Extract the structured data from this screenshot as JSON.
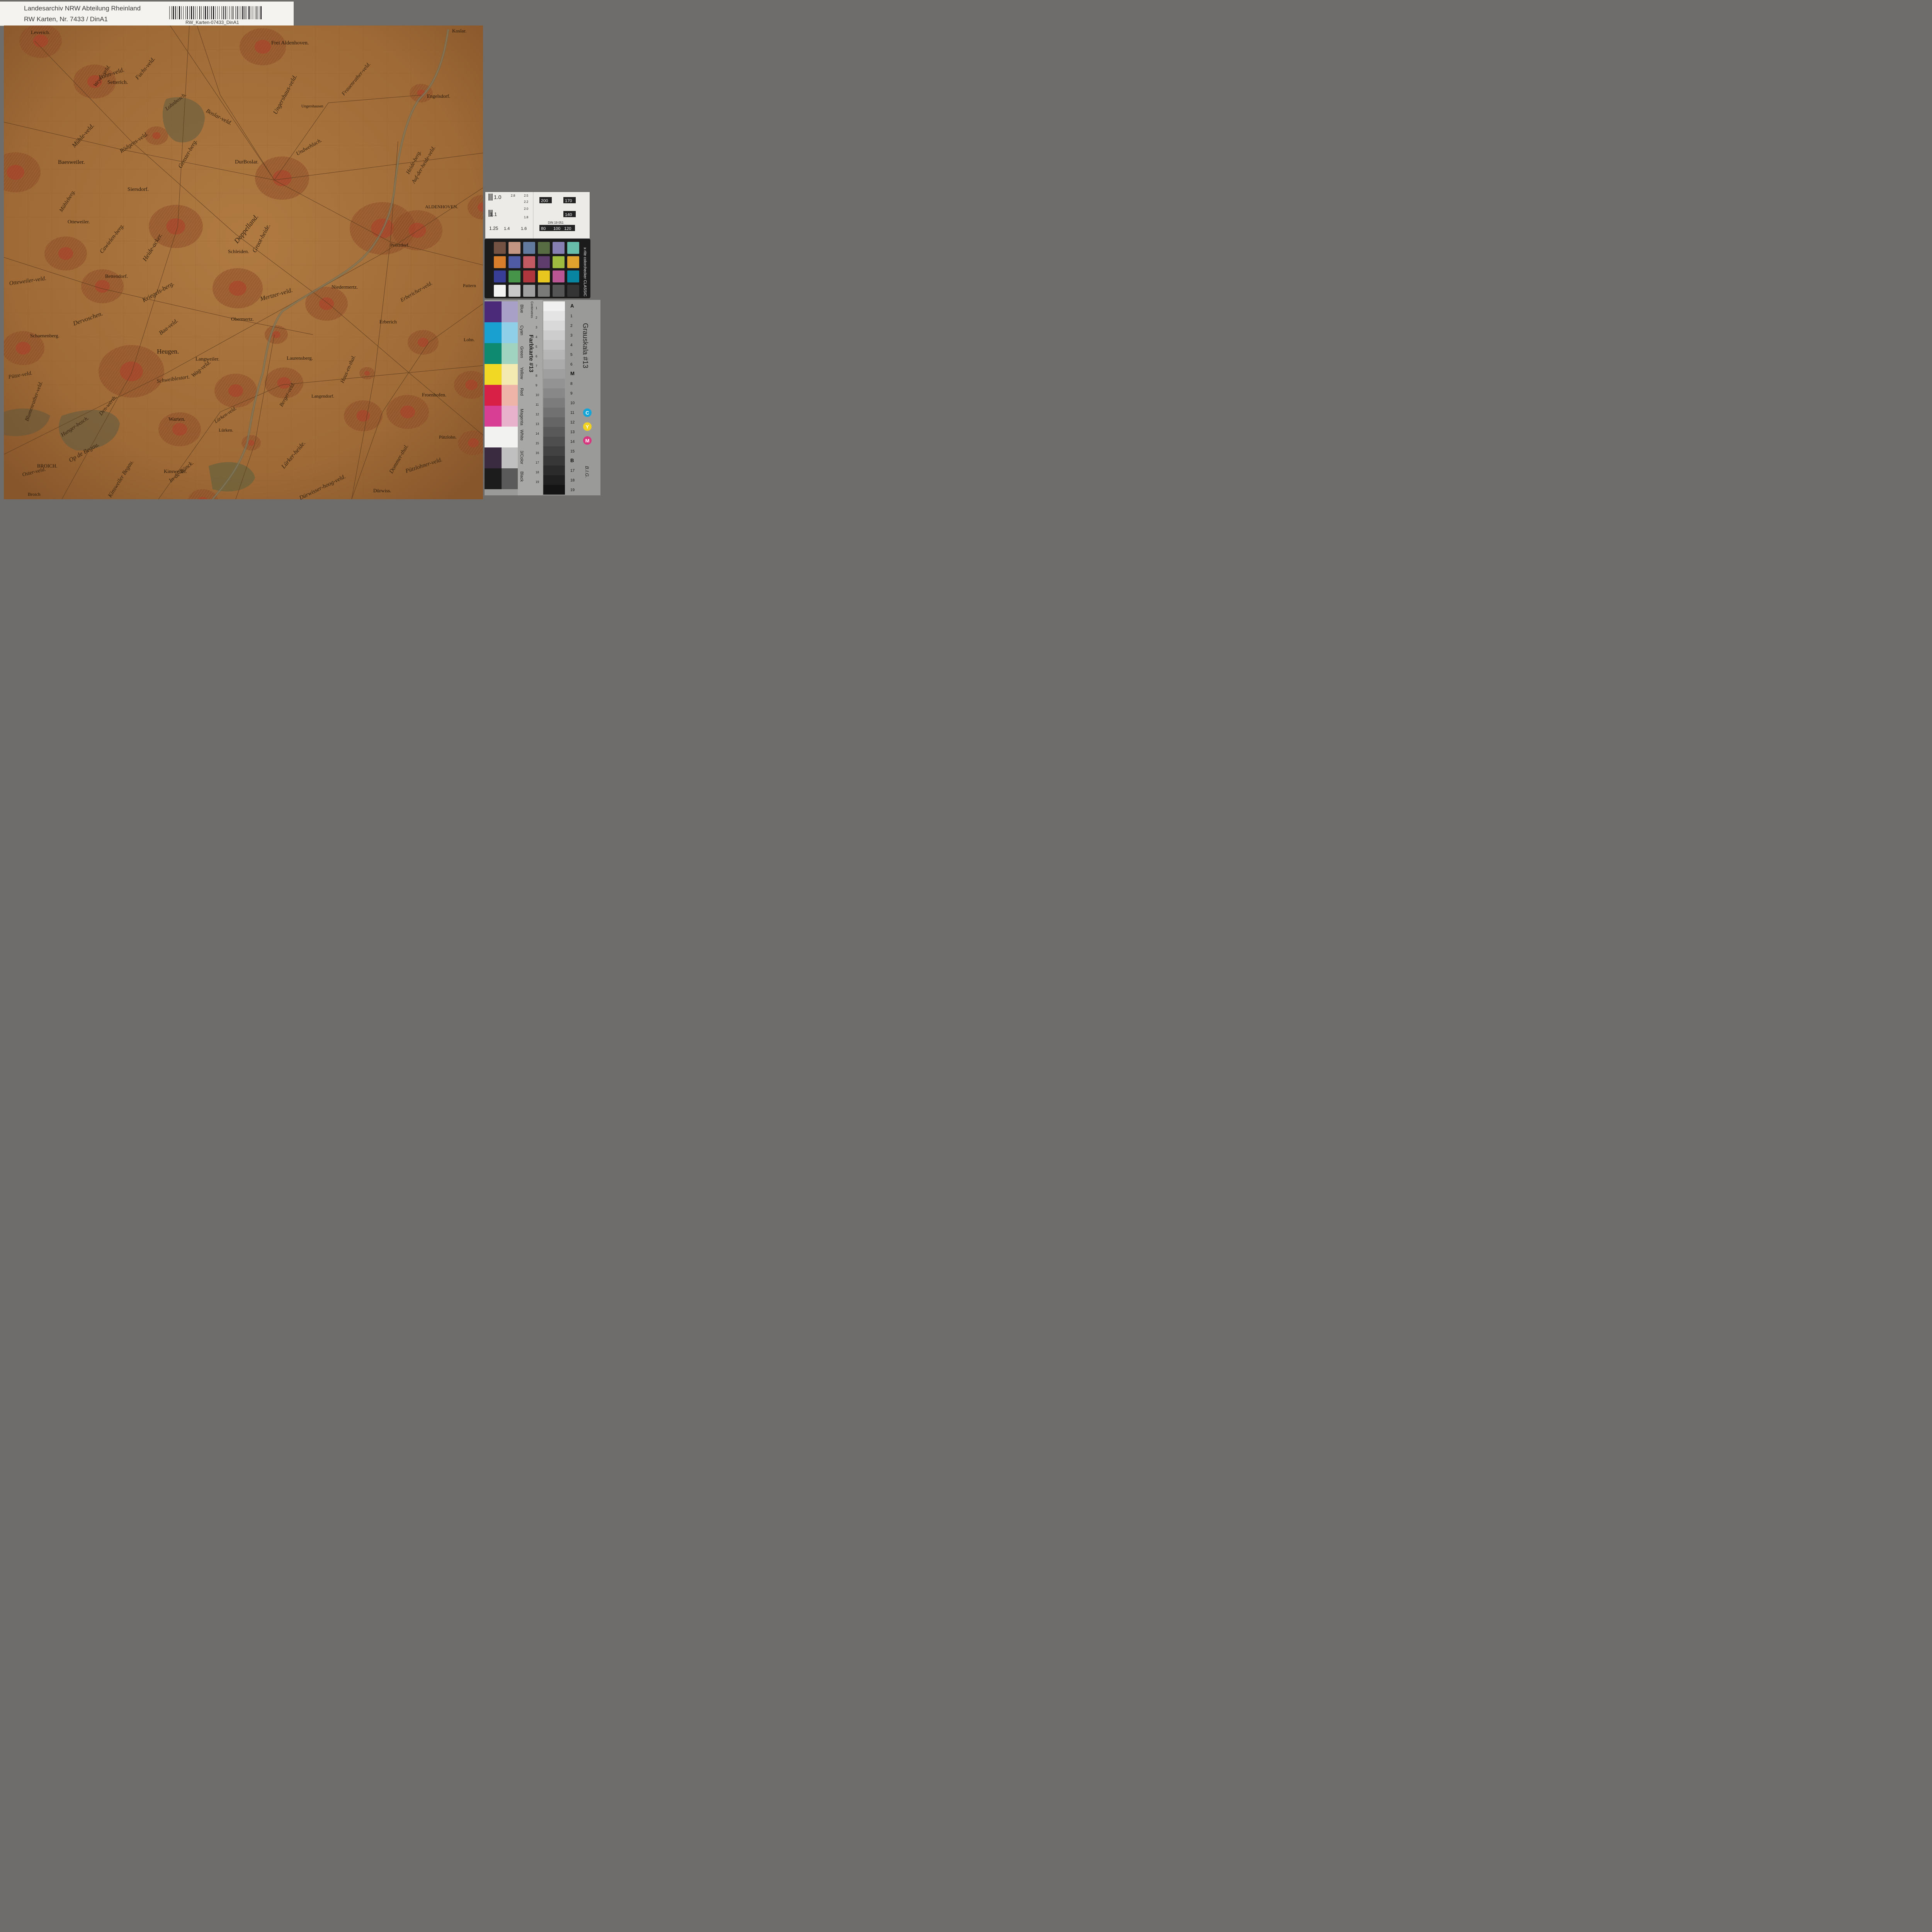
{
  "label": {
    "line1": "Landesarchiv NRW Abteilung Rheinland",
    "line2": "RW Karten,  Nr. 7433 / DinA1",
    "barcode_text": "RW_Karten-07433_DinA1"
  },
  "map": {
    "places": [
      {
        "name": "Leverich.",
        "size": 13
      },
      {
        "name": "Frei Aldenhoven.",
        "size": 14
      },
      {
        "name": "Koslar.",
        "size": 13
      },
      {
        "name": "Setterich.",
        "size": 14
      },
      {
        "name": "Engelsdorf.",
        "size": 13
      },
      {
        "name": "Ungershausen",
        "size": 10
      },
      {
        "name": "Baesweiler.",
        "size": 15
      },
      {
        "name": "DurBoslar.",
        "size": 14
      },
      {
        "name": "Siersdorf.",
        "size": 14
      },
      {
        "name": "ALDENHOVEN.",
        "size": 12
      },
      {
        "name": "Otteweiler.",
        "size": 13
      },
      {
        "name": "Schleiden.",
        "size": 13
      },
      {
        "name": "Pentzdorf.",
        "size": 12
      },
      {
        "name": "Bettendorf.",
        "size": 13
      },
      {
        "name": "Niedermertz.",
        "size": 13
      },
      {
        "name": "Pattern",
        "size": 12
      },
      {
        "name": "Obermertz.",
        "size": 13
      },
      {
        "name": "Erberich",
        "size": 13
      },
      {
        "name": "Schaenenberg.",
        "size": 13
      },
      {
        "name": "Heugen.",
        "size": 17
      },
      {
        "name": "Langweiler.",
        "size": 13
      },
      {
        "name": "Laurensberg.",
        "size": 13
      },
      {
        "name": "Lohn.",
        "size": 12
      },
      {
        "name": "Langendorf.",
        "size": 12
      },
      {
        "name": "Froenhofen.",
        "size": 13
      },
      {
        "name": "Warten.",
        "size": 14
      },
      {
        "name": "Lürken.",
        "size": 12
      },
      {
        "name": "Pützlohn.",
        "size": 12
      },
      {
        "name": "Kinsweiler.",
        "size": 13
      },
      {
        "name": "BROICH.",
        "size": 13
      },
      {
        "name": "Broich",
        "size": 12
      },
      {
        "name": "Dürwiss.",
        "size": 13
      }
    ],
    "fields": [
      {
        "name": "Weyer-veld.",
        "size": 14
      },
      {
        "name": "Fuchs-veld.",
        "size": 15
      },
      {
        "name": "Lohn-veld.",
        "size": 16
      },
      {
        "name": "Ungershaus-veld.",
        "size": 16
      },
      {
        "name": "Frauenrather-veld.",
        "size": 14
      },
      {
        "name": "Lohnbosch.",
        "size": 14
      },
      {
        "name": "Boslar-veld.",
        "size": 15
      },
      {
        "name": "Mühle-veld.",
        "size": 16
      },
      {
        "name": "Rödgens-veld.",
        "size": 15
      },
      {
        "name": "Undwehlach.",
        "size": 14
      },
      {
        "name": "Genster-berg.",
        "size": 15
      },
      {
        "name": "Mühleberg.",
        "size": 14
      },
      {
        "name": "Heide-berg.",
        "size": 14
      },
      {
        "name": "Auf-der-heide-veld.",
        "size": 14
      },
      {
        "name": "Doppelland.",
        "size": 18
      },
      {
        "name": "Groot-heide.",
        "size": 16
      },
      {
        "name": "Cawielen-berg.",
        "size": 15
      },
      {
        "name": "Heide-acker.",
        "size": 16
      },
      {
        "name": "Otteweiler-veld.",
        "size": 15
      },
      {
        "name": "Kriegels-berg.",
        "size": 16
      },
      {
        "name": "Dervoschen.",
        "size": 16
      },
      {
        "name": "Mertzer-veld.",
        "size": 16
      },
      {
        "name": "Erbericher-veld.",
        "size": 14
      },
      {
        "name": "Haus-en-thal.",
        "size": 14
      },
      {
        "name": "Baa-veld.",
        "size": 15
      },
      {
        "name": "Wag-veld.",
        "size": 15
      },
      {
        "name": "Pütze-veld.",
        "size": 14
      },
      {
        "name": "Schweiblestart.",
        "size": 14
      },
      {
        "name": "Den-werth.",
        "size": 14
      },
      {
        "name": "Lürken-veld.",
        "size": 13
      },
      {
        "name": "Hunger-bosch.",
        "size": 14
      },
      {
        "name": "Op de Begau.",
        "size": 16
      },
      {
        "name": "Lürker-heide.",
        "size": 16
      },
      {
        "name": "Dommer-thal.",
        "size": 15
      },
      {
        "name": "Kinsweiler Begau.",
        "size": 15
      },
      {
        "name": "In-de-Bünck.",
        "size": 15
      },
      {
        "name": "Dürwisser-hoog-veld.",
        "size": 15
      },
      {
        "name": "Pützlohner-veld.",
        "size": 15
      },
      {
        "name": "Oster-veld.",
        "size": 14
      },
      {
        "name": "Blumenrather-veld.",
        "size": 14
      },
      {
        "name": "Berger-veld.",
        "size": 14
      }
    ]
  },
  "colorchecker": {
    "brand": "x·rite colorchecker CLASSIC",
    "swatches": [
      "#735244",
      "#c29682",
      "#627a9d",
      "#576c43",
      "#8580b1",
      "#67bdaa",
      "#d67e2c",
      "#505ba6",
      "#c15a63",
      "#5e3c6c",
      "#9dbc40",
      "#e0a32e",
      "#383d96",
      "#469449",
      "#af363c",
      "#e7c71f",
      "#bb5695",
      "#0885a1",
      "#f3f3f2",
      "#c8c8c8",
      "#a0a0a0",
      "#7a7a79",
      "#555555",
      "#343434"
    ]
  },
  "scale_card": {
    "sizes": [
      "1.0",
      "1.1",
      "1.25",
      "1.4",
      "1.6",
      "2.8",
      "2.5",
      "2.2",
      "2.0",
      "1.8"
    ],
    "dpi": [
      "200",
      "170",
      "140",
      "120",
      "100",
      "80"
    ],
    "din": "DIN 19 051"
  },
  "farbkarte": {
    "title": "Farbkarte #13",
    "grayscale_title": "Grauskala #13",
    "brand": "B.I.G.",
    "centimetres": "Centimetres",
    "colors": [
      {
        "name": "Blue",
        "swatch": "#4b2a7a",
        "tint": "#a9a0c8"
      },
      {
        "name": "Cyan",
        "swatch": "#1aa0d0",
        "tint": "#8fd0e8"
      },
      {
        "name": "Green",
        "swatch": "#0e8a70",
        "tint": "#a0d4c0"
      },
      {
        "name": "Yellow",
        "swatch": "#f0d825",
        "tint": "#f2eab0"
      },
      {
        "name": "Red",
        "swatch": "#d81f45",
        "tint": "#eeb4a8"
      },
      {
        "name": "Magenta",
        "swatch": "#d83f94",
        "tint": "#e8b2cc"
      },
      {
        "name": "White",
        "swatch": "#f2f2f0",
        "tint": "#f2f2f0"
      },
      {
        "name": "3/Color",
        "swatch": "#3a2b40",
        "tint": "#c0c0c0"
      },
      {
        "name": "Black",
        "swatch": "#1c1c1c",
        "tint": "#5a5a5a"
      }
    ],
    "gray_labels": [
      "A",
      "1",
      "2",
      "3",
      "4",
      "5",
      "6",
      "M",
      "8",
      "9",
      "10",
      "11",
      "12",
      "13",
      "14",
      "15",
      "B",
      "17",
      "18",
      "19"
    ],
    "ruler": [
      "1",
      "2",
      "3",
      "4",
      "5",
      "6",
      "7",
      "8",
      "9",
      "10",
      "11",
      "12",
      "13",
      "14",
      "15",
      "16",
      "17",
      "18",
      "19"
    ],
    "cmy": [
      {
        "letter": "C",
        "color": "#13a4d8"
      },
      {
        "letter": "Y",
        "color": "#f2d21f"
      },
      {
        "letter": "M",
        "color": "#d8357f"
      }
    ]
  }
}
